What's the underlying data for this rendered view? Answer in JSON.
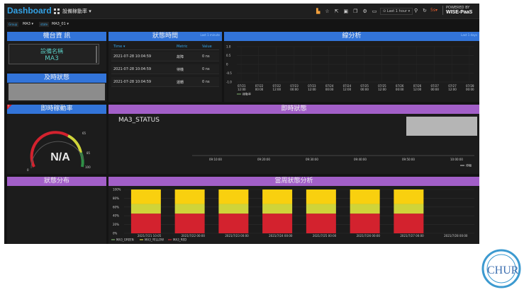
{
  "topbar": {
    "brand": "Dashboard",
    "dashboard_name": "設備稼動率 ▾",
    "icons": [
      "bar-chart-icon",
      "star-icon",
      "share-icon",
      "save-icon",
      "copy-icon",
      "settings-icon",
      "monitor-icon"
    ],
    "time_range": "⊙ Last 1 hour ▾",
    "refresh_rate": "5s▾",
    "powered_by": "POWERED BY",
    "brand_right": "WISE-PaaS"
  },
  "variables": [
    {
      "label": "Group",
      "value": "MA3 ▾"
    },
    {
      "label": "state",
      "value": "MA3_01 ▾"
    }
  ],
  "panels": {
    "device_info": {
      "title": "機台資 訊",
      "label": "設備名稱",
      "value": "MA3"
    },
    "realtime_status_small": {
      "title": "及時狀態"
    },
    "status_time": {
      "title": "狀態時間",
      "tag": "Last 1 minute",
      "columns": [
        "Time ▾",
        "Metric",
        "Value"
      ],
      "rows": [
        [
          "2021-07-28 10:04:59",
          "故障",
          "0 ns"
        ],
        [
          "2021-07-28 10:04:59",
          "待機",
          "0 ns"
        ],
        [
          "2021-07-28 10:04:59",
          "運轉",
          "0 ns"
        ]
      ]
    },
    "line_analysis": {
      "title": "線分析",
      "tag": "Last 1 days"
    },
    "utilization": {
      "title": "即時稼動率",
      "value": "N/A"
    },
    "realtime_status": {
      "title": "即時狀態",
      "series_label": "MA3_STATUS"
    },
    "status_distribution": {
      "title": "狀態分布"
    },
    "weekly_status": {
      "title": "當周狀態分析"
    }
  },
  "chart_data": [
    {
      "type": "line",
      "title": "線分析",
      "x": [
        "07/21 12:00",
        "07/22 00:00",
        "07/22 12:00",
        "07/23 00:00",
        "07/23 12:00",
        "07/24 00:00",
        "07/24 12:00",
        "07/25 00:00",
        "07/25 12:00",
        "07/26 00:00",
        "07/26 12:00",
        "07/27 00:00",
        "07/27 12:00",
        "07/28 00:00"
      ],
      "yticks": [
        "1.0",
        "0.5",
        "0",
        "-0.5",
        "-1.0"
      ],
      "ylim": [
        -1.0,
        1.0
      ],
      "series": [
        {
          "name": "稼動率",
          "values": []
        }
      ]
    },
    {
      "type": "line",
      "title": "即時狀態",
      "x": [
        "09:10:00",
        "09:20:00",
        "09:30:00",
        "09:40:00",
        "09:50:00",
        "10:00:00"
      ],
      "series": [
        {
          "name": "停機",
          "values": []
        }
      ]
    },
    {
      "type": "bar",
      "title": "當周狀態分析",
      "categories": [
        "2021/7/21 10:05",
        "2021/7/22 00:00",
        "2021/7/23 00:00",
        "2021/7/24 00:00",
        "2021/7/25 00:00",
        "2021/7/26 00:00",
        "2021/7/27 00:00",
        "2021/7/28 00:00"
      ],
      "yticks": [
        "100%",
        "80%",
        "60%",
        "40%",
        "20%",
        "0%"
      ],
      "ylim": [
        0,
        100
      ],
      "series": [
        {
          "name": "MA3_GREEN",
          "color": "#7eb26d",
          "values": [
            0,
            0,
            0,
            0,
            0,
            0,
            0,
            0
          ]
        },
        {
          "name": "MA3_YELLOW",
          "color": "#cfd43a",
          "values": [
            22,
            22,
            22,
            22,
            22,
            22,
            22,
            0
          ]
        },
        {
          "name": "MA3_RED",
          "color": "#d3222e",
          "values": [
            45,
            45,
            45,
            45,
            45,
            45,
            45,
            0
          ]
        }
      ],
      "top_segment": {
        "color": "#f9d00f",
        "values": [
          33,
          33,
          33,
          33,
          33,
          33,
          33,
          0
        ]
      }
    }
  ]
}
